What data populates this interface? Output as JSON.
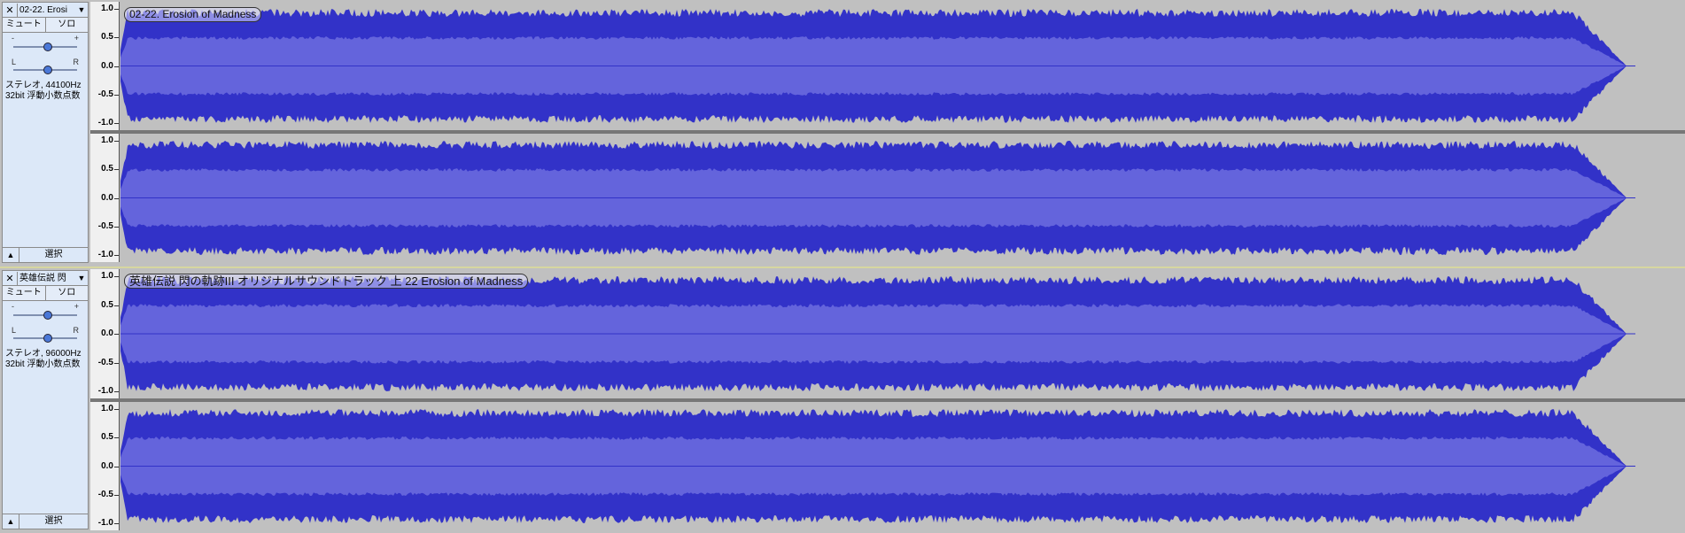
{
  "colors": {
    "wave_outer": "#3232c8",
    "wave_inner": "#6464dc",
    "background": "#c0c0c0",
    "panel": "#dce8f8"
  },
  "axis": {
    "ticks": [
      "1.0",
      "0.5",
      "0.0",
      "-0.5",
      "-1.0"
    ]
  },
  "tracks": [
    {
      "name": "02-22. Erosi",
      "mute_label": "ミュート",
      "solo_label": "ソロ",
      "gain_minus": "-",
      "gain_plus": "+",
      "pan_left": "L",
      "pan_right": "R",
      "info_line1": "ステレオ, 44100Hz",
      "info_line2": "32bit 浮動小数点数",
      "select_label": "選択",
      "clip_name": "02-22. Erosion of Madness"
    },
    {
      "name": "英雄伝説 閃",
      "mute_label": "ミュート",
      "solo_label": "ソロ",
      "gain_minus": "-",
      "gain_plus": "+",
      "pan_left": "L",
      "pan_right": "R",
      "info_line1": "ステレオ, 96000Hz",
      "info_line2": "32bit 浮動小数点数",
      "select_label": "選択",
      "clip_name": "英雄伝説 閃の軌跡III オリジナルサウンドトラック 上 22 Erosion of Madness"
    }
  ]
}
